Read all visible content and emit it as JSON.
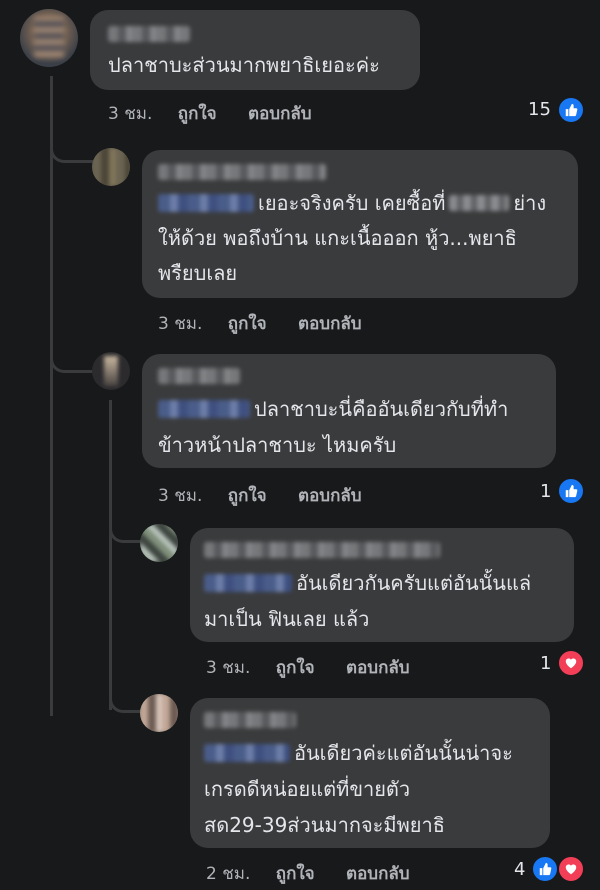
{
  "reaction_colors": {
    "like": "#1877f2",
    "love": "#f33e58"
  },
  "comments": [
    {
      "text_lines": [
        "ปลาชาบะส่วนมากพยาธิเยอะค่ะ"
      ],
      "time": "3 ชม.",
      "like_label": "ถูกใจ",
      "reply_label": "ตอบกลับ",
      "reaction_count": "15",
      "reactions": [
        "like"
      ]
    },
    {
      "text_lines": [
        "เยอะจริงครับ เคยซื้อที่",
        "ย่าง",
        "ให้ด้วย พอถึงบ้าน แกะเนื้อออก หู้ว...พยาธิ",
        "พรืยบเลย"
      ],
      "time": "3 ชม.",
      "like_label": "ถูกใจ",
      "reply_label": "ตอบกลับ"
    },
    {
      "text_lines": [
        "ปลาชาบะนี่คืออันเดียวกับที่ทำ",
        "ข้าวหน้าปลาชาบะ ไหมครับ"
      ],
      "time": "3 ชม.",
      "like_label": "ถูกใจ",
      "reply_label": "ตอบกลับ",
      "reaction_count": "1",
      "reactions": [
        "like"
      ]
    },
    {
      "text_lines": [
        "อันเดียวกันครับแต่อันนั้นแล่",
        "มาเป็น ฟินเลย แล้ว"
      ],
      "time": "3 ชม.",
      "like_label": "ถูกใจ",
      "reply_label": "ตอบกลับ",
      "reaction_count": "1",
      "reactions": [
        "love"
      ]
    },
    {
      "text_lines": [
        "อันเดียวค่ะแต่อันนั้นน่าจะ",
        "เกรดดีหน่อยแต่ที่ขายตัว",
        "สด29-39ส่วนมากจะมีพยาธิ"
      ],
      "time": "2 ชม.",
      "like_label": "ถูกใจ",
      "reply_label": "ตอบกลับ",
      "reaction_count": "4",
      "reactions": [
        "like",
        "love"
      ]
    }
  ]
}
